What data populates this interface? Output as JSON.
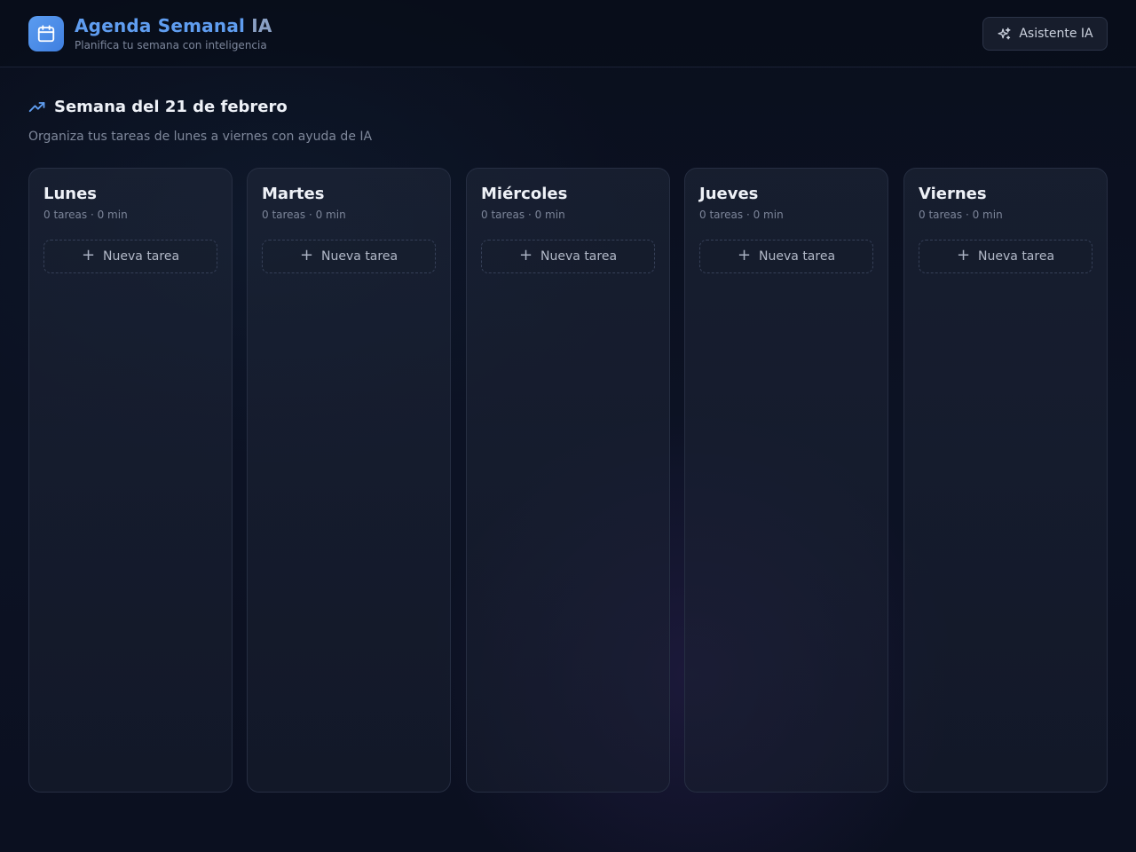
{
  "header": {
    "title_part1": "Agenda Semanal",
    "title_part2": "IA",
    "subtitle": "Planifica tu semana con inteligencia",
    "logo_icon": "calendar-icon",
    "assistant_button": "Asistente IA",
    "assistant_icon": "sparkles-icon"
  },
  "week": {
    "title": "Semana del 21 de febrero",
    "title_icon": "trending-up-icon",
    "subtitle": "Organiza tus tareas de lunes a viernes con ayuda de IA"
  },
  "days": [
    {
      "name": "Lunes",
      "meta": "0 tareas · 0 min",
      "new_task": "Nueva tarea"
    },
    {
      "name": "Martes",
      "meta": "0 tareas · 0 min",
      "new_task": "Nueva tarea"
    },
    {
      "name": "Miércoles",
      "meta": "0 tareas · 0 min",
      "new_task": "Nueva tarea"
    },
    {
      "name": "Jueves",
      "meta": "0 tareas · 0 min",
      "new_task": "Nueva tarea"
    },
    {
      "name": "Viernes",
      "meta": "0 tareas · 0 min",
      "new_task": "Nueva tarea"
    }
  ],
  "colors": {
    "accent": "#5f9df0",
    "background": "#0b1020",
    "panel": "#1a2133"
  }
}
